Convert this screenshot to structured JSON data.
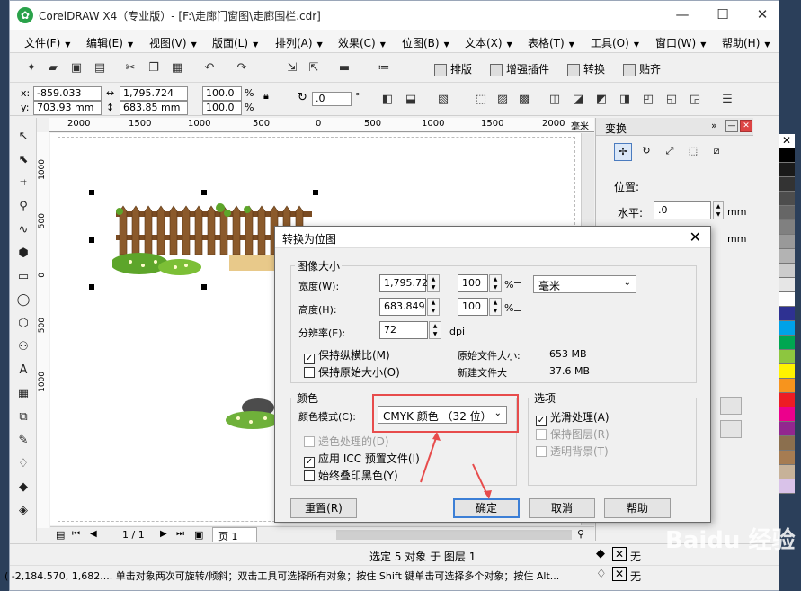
{
  "window": {
    "title": "CorelDRAW X4（专业版）- [F:\\走廊门窗图\\走廊围栏.cdr]",
    "controls": [
      "—",
      "☐",
      "✕"
    ]
  },
  "menu": [
    {
      "label": "文件(F)"
    },
    {
      "label": "编辑(E)"
    },
    {
      "label": "视图(V)"
    },
    {
      "label": "版面(L)"
    },
    {
      "label": "排列(A)"
    },
    {
      "label": "效果(C)"
    },
    {
      "label": "位图(B)"
    },
    {
      "label": "文本(X)"
    },
    {
      "label": "表格(T)"
    },
    {
      "label": "工具(O)"
    },
    {
      "label": "窗口(W)"
    },
    {
      "label": "帮助(H)"
    }
  ],
  "toolbar": {
    "buttons": [
      "排版",
      "增强插件",
      "转换",
      "贴齐"
    ]
  },
  "propbar": {
    "x_label": "x:",
    "x_value": "-859.033 mm",
    "y_label": "y:",
    "y_value": "703.93 mm",
    "w_value": "1,795.724 mm",
    "h_value": "683.85 mm",
    "sx_value": "100.0",
    "sy_value": "100.0",
    "pct": "%",
    "rot_value": ".0",
    "deg": "°"
  },
  "ruler_h": [
    "2000",
    "1500",
    "1000",
    "500",
    "0",
    "500",
    "1000",
    "1500",
    "2000",
    "毫米"
  ],
  "ruler_v": [
    "1000",
    "500",
    "0",
    "500",
    "1000"
  ],
  "docker": {
    "title": "变换",
    "section": "位置:",
    "h_label": "水平:",
    "h_value": ".0",
    "unit": "mm",
    "unit2": "mm"
  },
  "pagebar": {
    "pages": "1 / 1",
    "tab": "页 1"
  },
  "status": {
    "line1": "选定 5 对象 于 图层 1",
    "line2": "( -2,184.570, 1,682....  单击对象两次可旋转/倾斜；双击工具可选择所有对象；按住 Shift 键单击可选择多个对象；按住 Alt...",
    "fill_none": "无",
    "outline_none": "无"
  },
  "dialog": {
    "title": "转换为位图",
    "image_size": {
      "title": "图像大小",
      "width_label": "宽度(W):",
      "width_value": "1,795.724",
      "height_label": "高度(H):",
      "height_value": "683.849",
      "w_pct": "100",
      "h_pct": "100",
      "pct": "%",
      "unit": "毫米",
      "res_label": "分辨率(E):",
      "res_value": "72",
      "dpi": "dpi",
      "keep_ratio": "保持纵横比(M)",
      "keep_size": "保持原始大小(O)",
      "orig_size_label": "原始文件大小:",
      "orig_size_value": "653 MB",
      "new_size_label": "新建文件大",
      "new_size_value": "37.6 MB"
    },
    "color": {
      "title": "颜色",
      "mode_label": "颜色模式(C):",
      "mode_value": "CMYK 颜色 （32 位）",
      "dither": "递色处理的(D)",
      "icc": "应用 ICC 预置文件(I)",
      "overprint": "始终叠印黑色(Y)"
    },
    "options": {
      "title": "选项",
      "antialias": "光滑处理(A)",
      "keep_layers": "保持图层(R)",
      "transparent": "透明背景(T)"
    },
    "buttons": {
      "reset": "重置(R)",
      "ok": "确定",
      "cancel": "取消",
      "help": "帮助"
    }
  },
  "watermark": "Baidu 经验",
  "colors": {
    "highlight": "#e74c4c",
    "accent": "#3c7fd6",
    "app_logo": "#2aa24a"
  }
}
